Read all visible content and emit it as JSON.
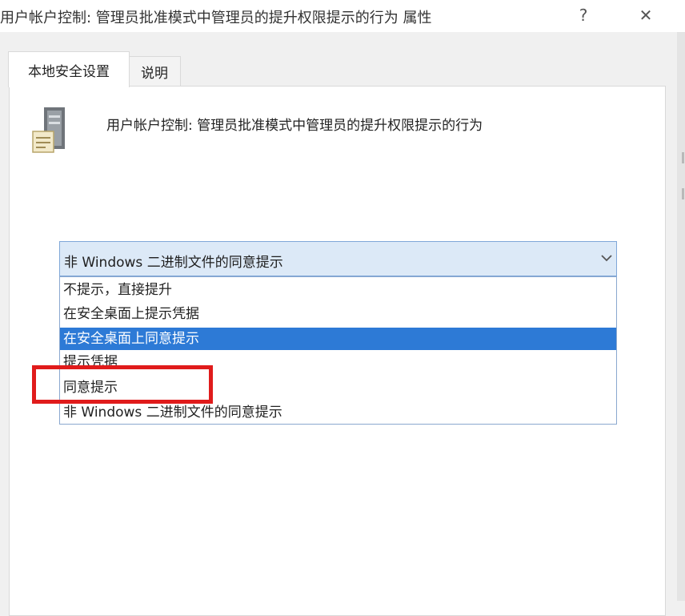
{
  "window": {
    "title": "用户帐户控制: 管理员批准模式中管理员的提升权限提示的行为 属性",
    "help_glyph": "?",
    "close_glyph": "✕"
  },
  "tabs": [
    {
      "label": "本地安全设置",
      "active": true
    },
    {
      "label": "说明",
      "active": false
    }
  ],
  "policy": {
    "title": "用户帐户控制: 管理员批准模式中管理员的提升权限提示的行为",
    "icon": "server-policy-icon"
  },
  "combo": {
    "value": "非 Windows 二进制文件的同意提示"
  },
  "options": [
    {
      "label": "不提示，直接提升"
    },
    {
      "label": "在安全桌面上提示凭据"
    },
    {
      "label": "在安全桌面上同意提示"
    },
    {
      "label": "提示凭据"
    },
    {
      "label": "同意提示"
    },
    {
      "label": "非 Windows 二进制文件的同意提示"
    }
  ],
  "selected_option_index": 2,
  "highlighted_option_index": 4,
  "colors": {
    "selection": "#2d7ad6",
    "highlight_box": "#e01b1b",
    "combo_background": "#dce9f7"
  }
}
